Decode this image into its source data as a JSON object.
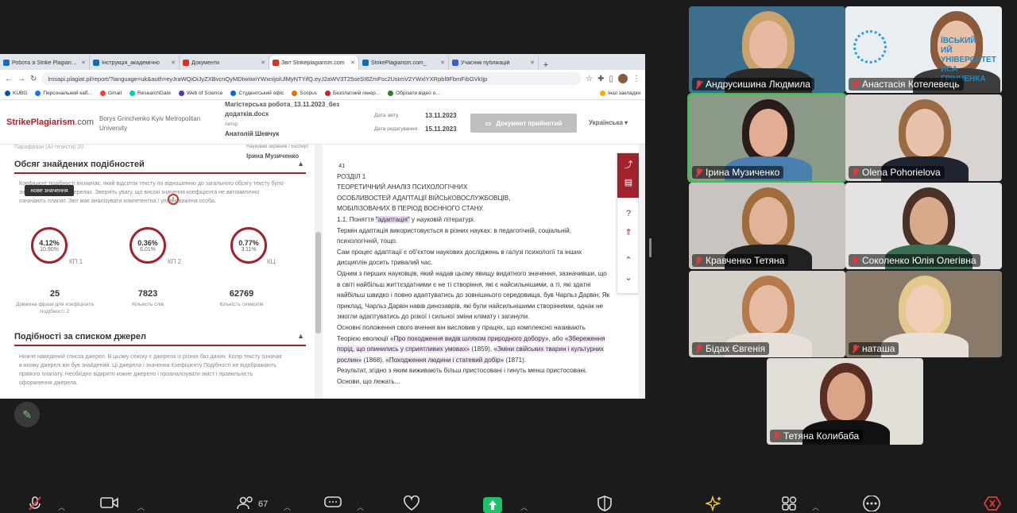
{
  "browser": {
    "tabs": [
      {
        "label": "Робота зі Strike Plagiarism",
        "color": "#0f6fb5"
      },
      {
        "label": "Інструкція_академічно",
        "color": "#0f6fb5"
      },
      {
        "label": "Документи",
        "color": "#d93025"
      },
      {
        "label": "Звіт Strikeplagiarism.com",
        "color": "#d93025"
      },
      {
        "label": "StrikePlagiarism.com_",
        "color": "#0f6fb5"
      },
      {
        "label": "Учасник публікацій",
        "color": "#3b5bdb"
      }
    ],
    "new_tab": "+",
    "url": "lmsapi.plagiat.pl/report/?language=uk&auth=eyJraWQiOiJyZXBvcnQyMDIwIiwiYWxnIjoiUlMyNTYifQ.eyJ2aWV3T25seSI6ZmFsc2UsImV2YWxlYXRpbl9FbmFibGVkIjp",
    "bookmarks": [
      {
        "label": "KUBG",
        "color": "#0b5394"
      },
      {
        "label": "Персональний каб...",
        "color": "#1a73e8"
      },
      {
        "label": "Gmail",
        "color": "#ea4335"
      },
      {
        "label": "ResearchGate",
        "color": "#00ccbb"
      },
      {
        "label": "Web of Science",
        "color": "#5e35b1"
      },
      {
        "label": "Студентський офіс",
        "color": "#1565c0"
      },
      {
        "label": "Scopus",
        "color": "#e37400"
      },
      {
        "label": "Безплатний генер...",
        "color": "#c62828"
      },
      {
        "label": "Обрізати відео о...",
        "color": "#2e7d32"
      },
      {
        "label": "Інші закладки",
        "color": "#f9ab00"
      }
    ]
  },
  "report": {
    "logo_brand": "StrikePlagiarism",
    "logo_domain": ".com",
    "university": "Borys Grinchenko Kyiv Metropolitan University",
    "doc_title_line1": "Магістерська робота_13.11.2023_без",
    "doc_title_line2": "додатків.docx",
    "author_label": "Автор",
    "author": "Анатолій Шевчук",
    "report_date_label": "Дата звіту",
    "report_date": "13.11.2023",
    "edit_date_label": "Дата редагування",
    "edit_date": "15.11.2023",
    "accept_button": "Документ прийнятий",
    "language": "Українська",
    "cut_row": "Парафрази (AI-тезисти)         20",
    "expert_label": "Науковий керівник / Експерт",
    "expert": "Ірина Музиченко",
    "section1_title": "Обсяг знайдених подібностей",
    "section1_desc": "Коефіцієнт подібності визначає, який відсоток тексту по відношенню до загального обсягу тексту було знайдено в різних джерелах. Зверніть увагу, що високі значення коефіцієнта не автоматично означають плагіат. Звіт має аналізувати компетентна / уповноважена особа.",
    "tooltip": "нове значення",
    "kp1_value": "4.12%",
    "kp1_prev": "10.90%",
    "kp1_label": "КП 1",
    "kp2_value": "0.36%",
    "kp2_prev": "6.01%",
    "kp2_label": "КП 2",
    "kc_value": "0.77%",
    "kc_prev": "3.11%",
    "kc_label": "КЦ",
    "warn": "!",
    "count_phrase": "25",
    "count_phrase_label": "Довжина фрази для коефіцієнта подібності 2",
    "count_words": "7823",
    "count_words_label": "Кількість слів",
    "count_chars": "62769",
    "count_chars_label": "Кількість символів",
    "section2_title": "Подібності за списком джерел",
    "section2_desc": "Нижче наведений список джерел. В цьому списку є джерела із різних баз даних. Колір тексту означає в якому джерелі він був знайдений. Ці джерела і значення Коефіцієнту Подібності не відображають прямого плагіату. Необхідно відкрити кожне джерело і проаналізувати зміст і правильність оформлення джерела."
  },
  "document": {
    "page_num": "41",
    "lines": [
      "РОЗДІЛ 1",
      "ТЕОРЕТИЧНИЙ АНАЛІЗ ПСИХОЛОГІЧНИХ",
      "ОСОБЛИВОСТЕЙ АДАПТАЦІЇ ВІЙСЬКОВОСЛУЖБОВЦІВ,",
      "МОБІЛІЗОВАНИХ В ПЕРІОД ВОЄННОГО СТАНУ."
    ],
    "p1_pre": "1.1. Поняття ",
    "p1_hl": "\"адаптація\"",
    "p1_post": " у науковій літературі.",
    "p2": "Термін адаптація використовується в різних науках: в педагогічній, соціальній, психологічній, тощо.",
    "p3": "Сам процес адаптації є об'єктом наукових досліджень в галузі психології та інших дисциплін досить тривалий час.",
    "p4": "Одним з перших науковців, який надав цьому явищу видатного значення, зазначивши, що в світі найбільш життєздатними є не ті створіння, які є найсильнішими, а ті, які здатні найбільш швидко і повно адаптуватись до зовнішнього середовища, був Чарльз Дарвін. Як приклад, Чарльз Дарвін навів динозаврів, які були найсильнішими створіннями, однак не змогли адаптуватись до різкої і сильної зміни клімату і загинули.",
    "p5_pre": "Основні положення свого вчення він висловив у працях, що комплексно називають Теорією еволюції ",
    "p5_hl1": "«Про походження видів шляхом природного добору»",
    "p5_mid1": ", або ",
    "p5_hl2": "«Збереження порід, що опинились у сприятливих умовах»",
    "p5_mid2": " (1859), ",
    "p5_hl3": "«Зміни свійських тварин і культурних рослин»",
    "p5_mid3": " (1868), ",
    "p5_hl4": "«Походження людини і статевий добір»",
    "p5_post": " (1871).",
    "p6": "Результат, згідно з яким виживають більш пристосовані і гинуть менш пристосовані. Основи, що лежать..."
  },
  "participants": [
    {
      "name": "Андрусишина Людмила",
      "bg": "#3d6e8c",
      "skin": "#e6b9a0",
      "hair": "#c9a36b",
      "shirt": "#2b2b2b"
    },
    {
      "name": "Анастасія Котелевець",
      "bg": "#e8eef2",
      "skin": "#e8c0a8",
      "hair": "#8a5a3a",
      "shirt": "#3c3c3c"
    },
    {
      "name": "Ірина Музиченко",
      "bg": "#8c9a8a",
      "skin": "#e2ad94",
      "hair": "#2a1d18",
      "shirt": "#4a7fb0"
    },
    {
      "name": "Olena Pohorielova",
      "bg": "#d9d4cf",
      "skin": "#e9c2ad",
      "hair": "#9a6b43",
      "shirt": "#1f2533"
    },
    {
      "name": "Кравченко Тетяна",
      "bg": "#c9c4bf",
      "skin": "#e1b49a",
      "hair": "#a06c3c",
      "shirt": "#222"
    },
    {
      "name": "Соколенко Юлія Олегівна",
      "bg": "#e3e3e3",
      "skin": "#d9a98c",
      "hair": "#4a3226",
      "shirt": "#3b6e55"
    },
    {
      "name": "Бідах Євгенія",
      "bg": "#d5d0c8",
      "skin": "#e6bca3",
      "hair": "#b87a4a",
      "shirt": "#e8e0d8"
    },
    {
      "name": "наташа",
      "bg": "#8a7a6a",
      "skin": "#efcdb7",
      "hair": "#e4c98f",
      "shirt": "#e6e0d8"
    },
    {
      "name": "Тетяна Колибаба",
      "bg": "#e1ddd7",
      "skin": "#d9a487",
      "hair": "#5a2e22",
      "shirt": "#111"
    }
  ],
  "university_logo_text": [
    "ЇВСЬКИЙ",
    "ИЙ УНІВЕРСИТЕТ",
    "ИСА ГРІНЧЕНКА"
  ],
  "toolbar": {
    "participants_count": "67"
  }
}
